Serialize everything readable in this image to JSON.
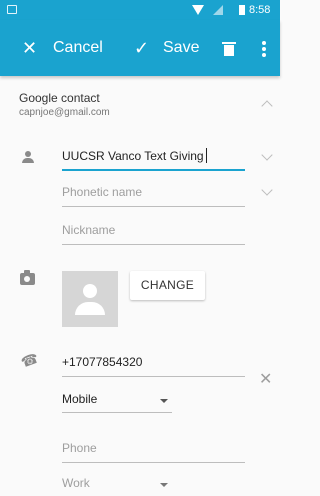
{
  "status_bar": {
    "time": "8:58"
  },
  "toolbar": {
    "cancel_label": "Cancel",
    "save_label": "Save"
  },
  "account": {
    "title": "Google contact",
    "email": "capnjoe@gmail.com"
  },
  "fields": {
    "name_value": "UUCSR Vanco Text Giving",
    "phonetic_placeholder": "Phonetic name",
    "nickname_placeholder": "Nickname"
  },
  "photo": {
    "change_label": "CHANGE"
  },
  "phones": [
    {
      "number": "+17077854320",
      "type": "Mobile"
    },
    {
      "placeholder": "Phone",
      "type": "Work"
    }
  ]
}
